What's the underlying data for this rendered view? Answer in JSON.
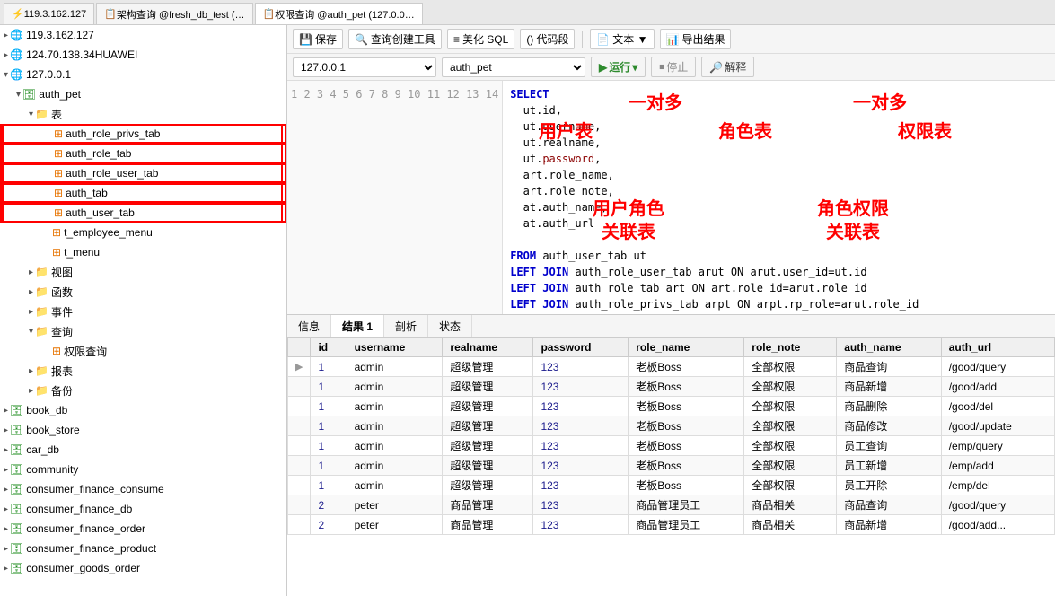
{
  "tabs": [
    {
      "label": "119.3.162.127",
      "active": false,
      "icon": "⚡"
    },
    {
      "label": "架构查询 @fresh_db_test (…",
      "active": false,
      "icon": "📋"
    },
    {
      "label": "权限查询 @auth_pet (127.0.0…",
      "active": true,
      "icon": "📋"
    }
  ],
  "toolbar": {
    "save": "保存",
    "query_tool": "查询创建工具",
    "beautify_sql": "美化 SQL",
    "code_snippet": "代码段",
    "text": "文本 ▼",
    "export": "导出结果"
  },
  "conn_bar": {
    "host": "127.0.0.1",
    "db": "auth_pet",
    "run": "运行",
    "stop": "停止",
    "explain": "解释"
  },
  "code_lines": [
    {
      "num": 1,
      "text": "SELECT",
      "parts": [
        {
          "type": "kw",
          "text": "SELECT"
        }
      ]
    },
    {
      "num": 2,
      "text": "  ut.id,"
    },
    {
      "num": 3,
      "text": "  ut.username,"
    },
    {
      "num": 4,
      "text": "  ut.realname,"
    },
    {
      "num": 5,
      "text": "  ut.password,"
    },
    {
      "num": 6,
      "text": "  art.role_name,"
    },
    {
      "num": 7,
      "text": "  art.role_note,"
    },
    {
      "num": 8,
      "text": "  at.auth_name,"
    },
    {
      "num": 9,
      "text": "  at.auth_url"
    },
    {
      "num": 10,
      "text": ""
    },
    {
      "num": 11,
      "text": "FROM auth_user_tab ut"
    },
    {
      "num": 12,
      "text": "LEFT JOIN auth_role_user_tab arut ON arut.user_id=ut.id"
    },
    {
      "num": 13,
      "text": "LEFT JOIN auth_role_tab art ON art.role_id=arut.role_id"
    },
    {
      "num": 14,
      "text": "LEFT JOIN auth_role_privs_tab arpt ON arpt.rp_role=arut.role_id"
    }
  ],
  "annotations": {
    "one_to_many_1": "一对多",
    "one_to_many_2": "一对多",
    "user_table": "用户表",
    "role_table": "角色表",
    "priv_table": "权限表",
    "user_role_join": "用户角色\n关联表",
    "role_priv_join": "角色权限\n关联表"
  },
  "bottom_tabs": [
    "信息",
    "结果 1",
    "剖析",
    "状态"
  ],
  "active_bottom_tab": "结果 1",
  "table": {
    "columns": [
      "id",
      "username",
      "realname",
      "password",
      "role_name",
      "role_note",
      "auth_name",
      "auth_url"
    ],
    "rows": [
      {
        "id": "1",
        "username": "admin",
        "realname": "超级管理",
        "password": "123",
        "role_name": "老板Boss",
        "role_note": "全部权限",
        "auth_name": "商品查询",
        "auth_url": "/good/query"
      },
      {
        "id": "1",
        "username": "admin",
        "realname": "超级管理",
        "password": "123",
        "role_name": "老板Boss",
        "role_note": "全部权限",
        "auth_name": "商品新增",
        "auth_url": "/good/add"
      },
      {
        "id": "1",
        "username": "admin",
        "realname": "超级管理",
        "password": "123",
        "role_name": "老板Boss",
        "role_note": "全部权限",
        "auth_name": "商品删除",
        "auth_url": "/good/del"
      },
      {
        "id": "1",
        "username": "admin",
        "realname": "超级管理",
        "password": "123",
        "role_name": "老板Boss",
        "role_note": "全部权限",
        "auth_name": "商品修改",
        "auth_url": "/good/update"
      },
      {
        "id": "1",
        "username": "admin",
        "realname": "超级管理",
        "password": "123",
        "role_name": "老板Boss",
        "role_note": "全部权限",
        "auth_name": "员工查询",
        "auth_url": "/emp/query"
      },
      {
        "id": "1",
        "username": "admin",
        "realname": "超级管理",
        "password": "123",
        "role_name": "老板Boss",
        "role_note": "全部权限",
        "auth_name": "员工新增",
        "auth_url": "/emp/add"
      },
      {
        "id": "1",
        "username": "admin",
        "realname": "超级管理",
        "password": "123",
        "role_name": "老板Boss",
        "role_note": "全部权限",
        "auth_name": "员工开除",
        "auth_url": "/emp/del"
      },
      {
        "id": "2",
        "username": "peter",
        "realname": "商品管理",
        "password": "123",
        "role_name": "商品管理员工",
        "role_note": "商品相关",
        "auth_name": "商品查询",
        "auth_url": "/good/query"
      },
      {
        "id": "2",
        "username": "peter",
        "realname": "商品管理",
        "password": "123",
        "role_name": "商品管理员工",
        "role_note": "商品相关",
        "auth_name": "商品新增",
        "auth_url": "/good/add..."
      }
    ]
  },
  "sidebar": {
    "items": [
      {
        "level": 0,
        "type": "ip",
        "label": "119.3.162.127",
        "expand": false,
        "icon": "net"
      },
      {
        "level": 0,
        "type": "ip",
        "label": "124.70.138.34HUAWEI",
        "expand": false,
        "icon": "net"
      },
      {
        "level": 0,
        "type": "ip",
        "label": "127.0.0.1",
        "expand": true,
        "icon": "net"
      },
      {
        "level": 1,
        "type": "db",
        "label": "auth_pet",
        "expand": true,
        "icon": "db"
      },
      {
        "level": 2,
        "type": "folder",
        "label": "表",
        "expand": true,
        "icon": "folder"
      },
      {
        "level": 3,
        "type": "table",
        "label": "auth_role_privs_tab",
        "selected": true,
        "icon": "table"
      },
      {
        "level": 3,
        "type": "table",
        "label": "auth_role_tab",
        "selected": true,
        "icon": "table"
      },
      {
        "level": 3,
        "type": "table",
        "label": "auth_role_user_tab",
        "selected": true,
        "icon": "table"
      },
      {
        "level": 3,
        "type": "table",
        "label": "auth_tab",
        "selected": true,
        "icon": "table"
      },
      {
        "level": 3,
        "type": "table",
        "label": "auth_user_tab",
        "selected": true,
        "icon": "table"
      },
      {
        "level": 3,
        "type": "table",
        "label": "t_employee_menu",
        "selected": false,
        "icon": "table"
      },
      {
        "level": 3,
        "type": "table",
        "label": "t_menu",
        "selected": false,
        "icon": "table"
      },
      {
        "level": 2,
        "type": "folder",
        "label": "视图",
        "expand": false,
        "icon": "folder"
      },
      {
        "level": 2,
        "type": "folder",
        "label": "函数",
        "expand": false,
        "icon": "folder"
      },
      {
        "level": 2,
        "type": "folder",
        "label": "事件",
        "expand": false,
        "icon": "folder"
      },
      {
        "level": 2,
        "type": "folder",
        "label": "查询",
        "expand": true,
        "icon": "folder"
      },
      {
        "level": 3,
        "type": "query",
        "label": "权限查询",
        "selected": false,
        "icon": "query"
      },
      {
        "level": 2,
        "type": "folder",
        "label": "报表",
        "expand": false,
        "icon": "folder"
      },
      {
        "level": 2,
        "type": "folder",
        "label": "备份",
        "expand": false,
        "icon": "folder"
      },
      {
        "level": 0,
        "type": "db",
        "label": "book_db",
        "expand": false,
        "icon": "db"
      },
      {
        "level": 0,
        "type": "db",
        "label": "book_store",
        "expand": false,
        "icon": "db"
      },
      {
        "level": 0,
        "type": "db",
        "label": "car_db",
        "expand": false,
        "icon": "db"
      },
      {
        "level": 0,
        "type": "db",
        "label": "community",
        "expand": false,
        "icon": "db"
      },
      {
        "level": 0,
        "type": "db",
        "label": "consumer_finance_consume",
        "expand": false,
        "icon": "db"
      },
      {
        "level": 0,
        "type": "db",
        "label": "consumer_finance_db",
        "expand": false,
        "icon": "db"
      },
      {
        "level": 0,
        "type": "db",
        "label": "consumer_finance_order",
        "expand": false,
        "icon": "db"
      },
      {
        "level": 0,
        "type": "db",
        "label": "consumer_finance_product",
        "expand": false,
        "icon": "db"
      },
      {
        "level": 0,
        "type": "db",
        "label": "consumer_goods_order",
        "expand": false,
        "icon": "db"
      }
    ]
  }
}
